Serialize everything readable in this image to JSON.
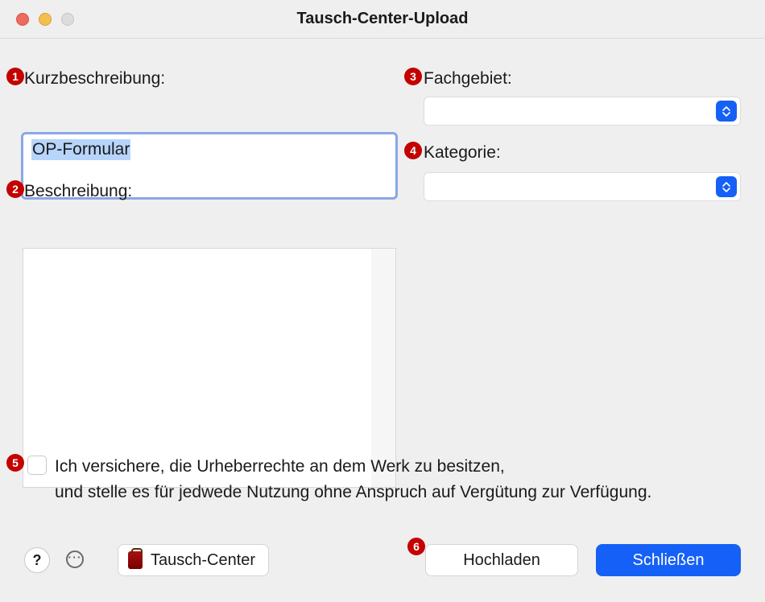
{
  "window": {
    "title": "Tausch-Center-Upload"
  },
  "badges": {
    "b1": "1",
    "b2": "2",
    "b3": "3",
    "b4": "4",
    "b5": "5",
    "b6": "6"
  },
  "labels": {
    "short_desc": "Kurzbeschreibung:",
    "desc": "Beschreibung:",
    "subject": "Fachgebiet:",
    "category": "Kategorie:"
  },
  "short_desc_value": "OP-Formular",
  "subject_value": "",
  "category_value": "",
  "consent_line1": "Ich versichere, die Urheberrechte an dem Werk zu besitzen,",
  "consent_line2": "und stelle es für jedwede Nutzung ohne Anspruch auf Vergütung zur Verfügung.",
  "buttons": {
    "help": "?",
    "tausch_center": "Tausch-Center",
    "upload": "Hochladen",
    "close": "Schließen"
  }
}
